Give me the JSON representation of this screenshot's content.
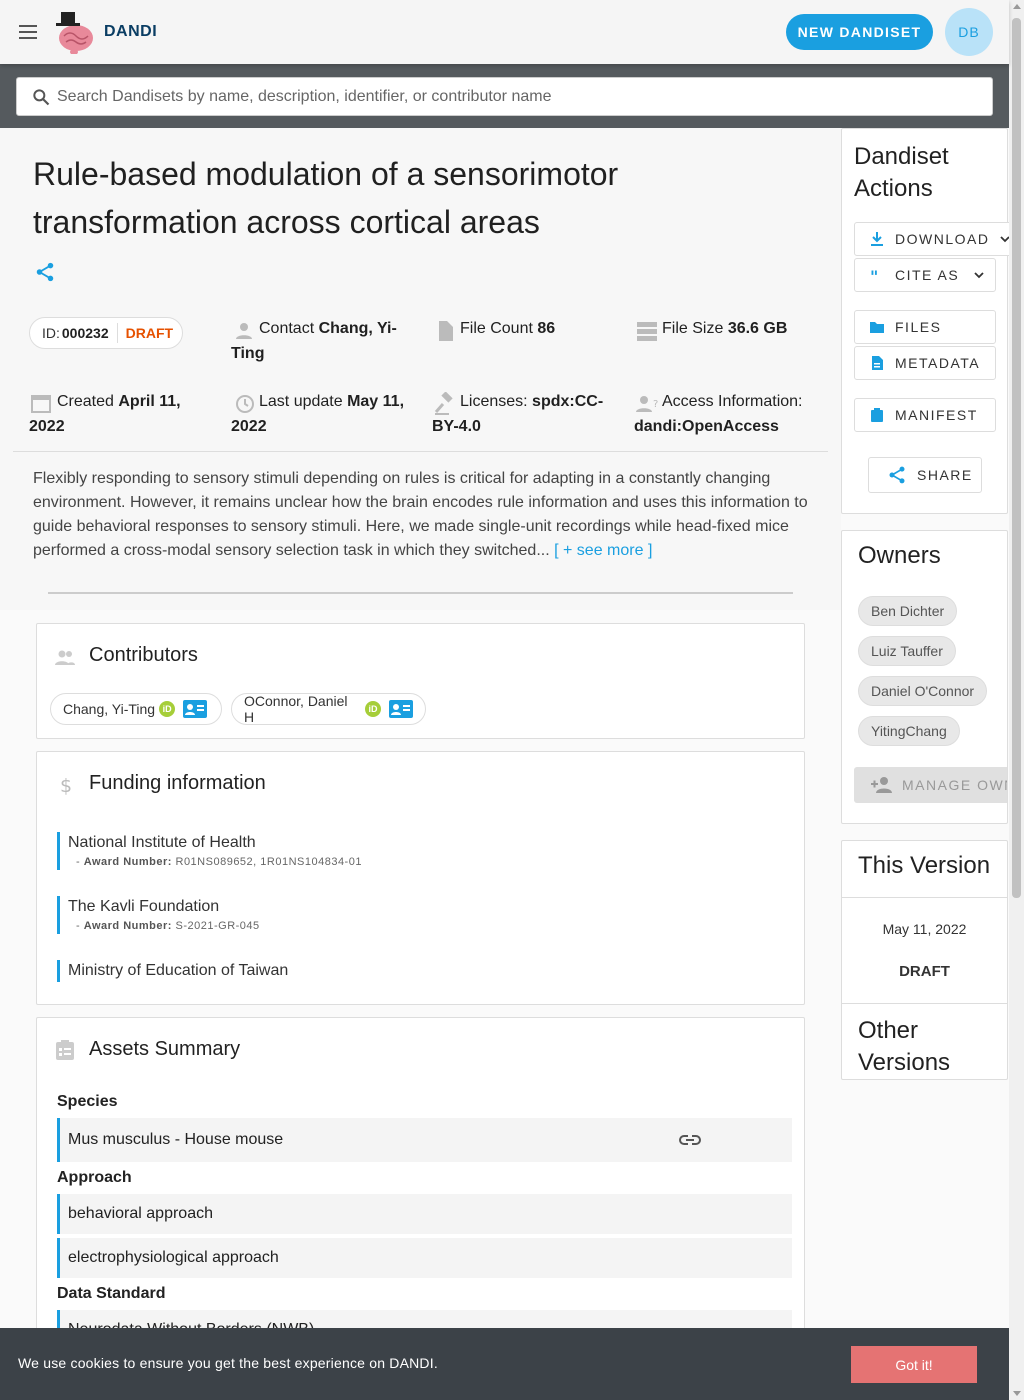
{
  "header": {
    "brand": "DANDI",
    "new_button": "NEW DANDISET",
    "avatar_initials": "DB"
  },
  "search": {
    "placeholder": "Search Dandisets by name, description, identifier, or contributor name"
  },
  "dandiset": {
    "title": "Rule-based modulation of a sensorimotor transformation across cortical areas",
    "id_label": "ID:",
    "id": "000232",
    "status": "DRAFT",
    "contact_label": "Contact",
    "contact": "Chang, Yi-Ting",
    "file_count_label": "File Count",
    "file_count": "86",
    "file_size_label": "File Size",
    "file_size": "36.6 GB",
    "created_label": "Created",
    "created": "April 11, 2022",
    "updated_label": "Last update",
    "updated": "May 11, 2022",
    "licenses_label": "Licenses:",
    "license": "spdx:CC-BY-4.0",
    "access_label": "Access Information:",
    "access": "dandi:OpenAccess",
    "description": "Flexibly responding to sensory stimuli depending on rules is critical for adapting in a constantly changing environment. However, it remains unclear how the brain encodes rule information and uses this information to guide behavioral responses to sensory stimuli. Here, we made single-unit recordings while head-fixed mice performed a cross-modal sensory selection task in which they switched...",
    "see_more": "[ + see more ]"
  },
  "contributors": {
    "title": "Contributors",
    "items": [
      {
        "name": "Chang, Yi-Ting"
      },
      {
        "name": "OConnor, Daniel H"
      }
    ]
  },
  "funding": {
    "title": "Funding information",
    "award_label": "Award Number:",
    "items": [
      {
        "name": "National Institute of Health",
        "award": "R01NS089652, 1R01NS104834-01"
      },
      {
        "name": "The Kavli Foundation",
        "award": "S-2021-GR-045"
      },
      {
        "name": "Ministry of Education of Taiwan",
        "award": ""
      }
    ]
  },
  "assets": {
    "title": "Assets Summary",
    "species_label": "Species",
    "species": [
      "Mus musculus - House mouse"
    ],
    "approach_label": "Approach",
    "approaches": [
      "behavioral approach",
      "electrophysiological approach"
    ],
    "standard_label": "Data Standard",
    "standards": [
      "Neurodata Without Borders (NWB)"
    ]
  },
  "actions": {
    "title": "Dandiset Actions",
    "download": "DOWNLOAD",
    "cite": "CITE AS",
    "files": "FILES",
    "metadata": "METADATA",
    "manifest": "MANIFEST",
    "share": "SHARE"
  },
  "owners": {
    "title": "Owners",
    "items": [
      "Ben Dichter",
      "Luiz Tauffer",
      "Daniel O'Connor",
      "YitingChang"
    ],
    "manage": "MANAGE OWNERS"
  },
  "version": {
    "title": "This Version",
    "date": "May 11, 2022",
    "status": "DRAFT",
    "other_title": "Other Versions"
  },
  "cookie": {
    "text": "We use cookies to ensure you get the best experience on DANDI.",
    "button": "Got it!"
  },
  "colors": {
    "accent": "#1a9fe0",
    "draft": "#e65100",
    "cookie_bg": "#3c4248",
    "cookie_button": "#e57373"
  }
}
